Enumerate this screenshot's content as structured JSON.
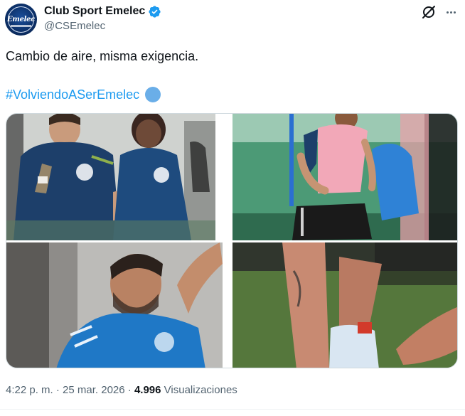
{
  "author": {
    "display_name": "Club Sport Emelec",
    "handle": "@CSEmelec",
    "avatar_text": "Emelec",
    "verified": true
  },
  "tweet": {
    "text": "Cambio de aire, misma exigencia.",
    "hashtag": "#VolviendoASerEmelec"
  },
  "media": {
    "photos": [
      {
        "name": "players-running-photo"
      },
      {
        "name": "player-bib-photo"
      },
      {
        "name": "player-closeup-photo"
      },
      {
        "name": "ankle-stretch-photo"
      }
    ]
  },
  "meta": {
    "time": "4:22 p. m.",
    "separator": " · ",
    "date": "25 mar. 2026",
    "view_count": "4.996",
    "views_label": "Visualizaciones"
  },
  "colors": {
    "link": "#1d9bf0",
    "verified": "#1d9bf0",
    "secondary_text": "#536471",
    "primary_text": "#0f1419"
  }
}
